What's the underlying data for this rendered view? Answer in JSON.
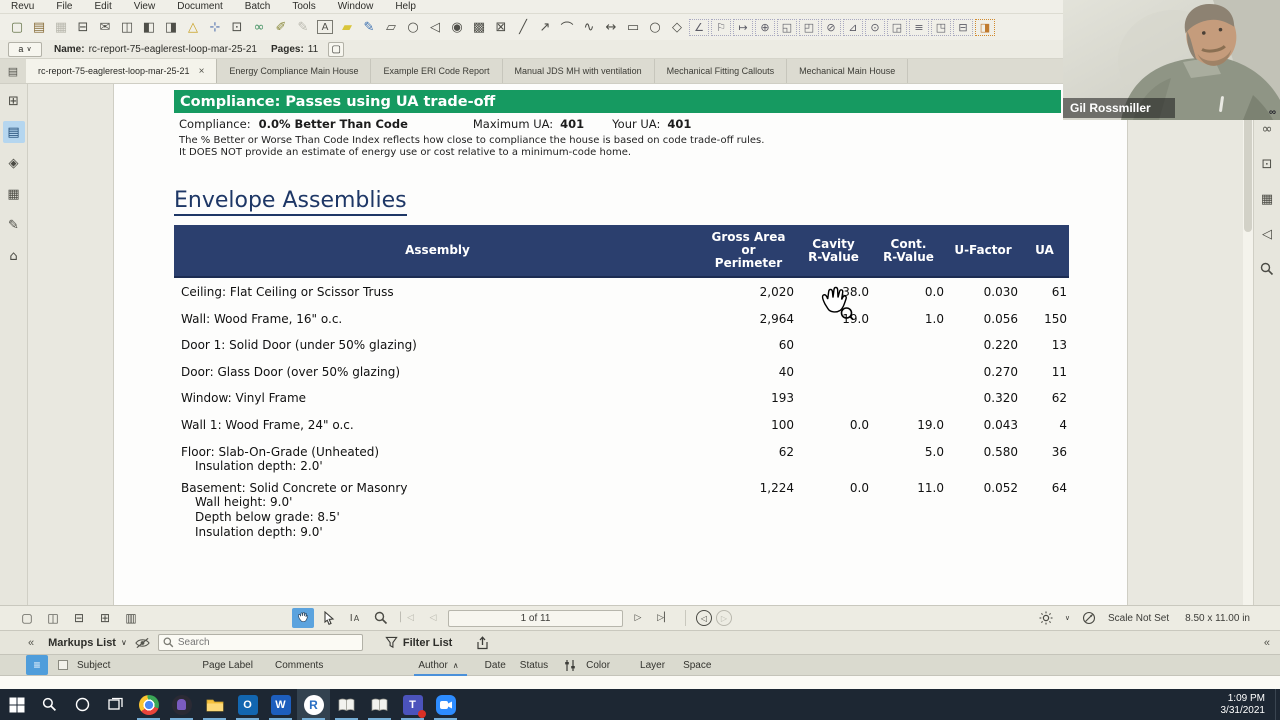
{
  "colors": {
    "banner_green": "#169a61",
    "table_navy": "#2b3f6e",
    "heading_navy": "#1e3766",
    "accent_blue": "#5ba3de",
    "taskbar_dark": "#1d2733"
  },
  "menu": {
    "items": [
      "Revu",
      "File",
      "Edit",
      "View",
      "Document",
      "Batch",
      "Tools",
      "Window",
      "Help"
    ]
  },
  "toolbar_icons": [
    {
      "n": "new-document-icon",
      "g": "▢",
      "c": "#66754a"
    },
    {
      "n": "open-file-icon",
      "g": "▤",
      "c": "#8a6f3c"
    },
    {
      "n": "save-icon",
      "g": "▦",
      "c": "#b9b8ae"
    },
    {
      "n": "print-icon",
      "g": "⊟",
      "c": "#4f4f49"
    },
    {
      "n": "email-icon",
      "g": "✉",
      "c": "#4f4f49"
    },
    {
      "n": "panels-layout-icon",
      "g": "◫",
      "c": "#4f4f49"
    },
    {
      "n": "extract-pages-icon",
      "g": "◧",
      "c": "#4f4f49"
    },
    {
      "n": "insert-pages-icon",
      "g": "◨",
      "c": "#4f4f49"
    },
    {
      "n": "alert-bell-icon",
      "g": "△",
      "c": "#c9a227"
    },
    {
      "n": "select-crosshair-icon",
      "g": "⊹",
      "c": "#4f6fae"
    },
    {
      "n": "snapshot-icon",
      "g": "⊡",
      "c": "#4f4f49"
    },
    {
      "n": "hyperlink-icon",
      "g": "∞",
      "c": "#3f8f5f"
    },
    {
      "n": "attachment-icon",
      "g": "✐",
      "c": "#8a8a3c"
    },
    {
      "n": "format-painter-icon",
      "g": "✎",
      "c": "#b9b8ae"
    },
    {
      "n": "text-box-icon",
      "g": "A",
      "c": "#4f4f49",
      "cls": "boxed"
    },
    {
      "n": "highlighter-icon",
      "g": "▰",
      "c": "#d9c53a"
    },
    {
      "n": "pen-icon",
      "g": "✎",
      "c": "#3a6fb0"
    },
    {
      "n": "cloud-icon",
      "g": "▱",
      "c": "#4f4f49"
    },
    {
      "n": "ellipse-markup-icon",
      "g": "○",
      "c": "#4f4f49"
    },
    {
      "n": "callout-icon",
      "g": "◁",
      "c": "#4f4f49"
    },
    {
      "n": "stamp-icon",
      "g": "◉",
      "c": "#4f4f49"
    },
    {
      "n": "image-icon",
      "g": "▩",
      "c": "#4f4f49"
    },
    {
      "n": "crop-icon",
      "g": "⊠",
      "c": "#4f4f49"
    },
    {
      "n": "line-tool-icon",
      "g": "╱",
      "c": "#4f4f49"
    },
    {
      "n": "arrow-tool-icon",
      "g": "↗",
      "c": "#4f4f49"
    },
    {
      "n": "arc-tool-icon",
      "g": "⌒",
      "c": "#4f4f49"
    },
    {
      "n": "polyline-tool-icon",
      "g": "∿",
      "c": "#4f4f49"
    },
    {
      "n": "dimension-tool-icon",
      "g": "↔",
      "c": "#4f4f49"
    },
    {
      "n": "rectangle-tool-icon",
      "g": "▭",
      "c": "#4f4f49"
    },
    {
      "n": "ellipse-tool-icon",
      "g": "○",
      "c": "#4f4f49"
    },
    {
      "n": "polygon-tool-icon",
      "g": "◇",
      "c": "#4f4f49"
    },
    {
      "n": "measure-angle-icon",
      "g": "∠",
      "cls": "measure"
    },
    {
      "n": "measure-flag-icon",
      "g": "⚐",
      "cls": "measure"
    },
    {
      "n": "measure-length-icon",
      "g": "↦",
      "cls": "measure"
    },
    {
      "n": "measure-calibrate-icon",
      "g": "⊕",
      "cls": "measure"
    },
    {
      "n": "measure-area-icon",
      "g": "◱",
      "cls": "measure"
    },
    {
      "n": "measure-perimeter-icon",
      "g": "◰",
      "cls": "measure"
    },
    {
      "n": "measure-diameter-icon",
      "g": "⊘",
      "cls": "measure"
    },
    {
      "n": "measure-slope-icon",
      "g": "⊿",
      "cls": "measure"
    },
    {
      "n": "measure-radius-icon",
      "g": "⊙",
      "cls": "measure"
    },
    {
      "n": "measure-volume-icon",
      "g": "◲",
      "cls": "measure"
    },
    {
      "n": "measure-count-icon",
      "g": "≡",
      "cls": "measure"
    },
    {
      "n": "measure-cutout-icon",
      "g": "◳",
      "cls": "measure"
    },
    {
      "n": "measure-width-icon",
      "g": "⊟",
      "cls": "measure"
    },
    {
      "n": "dynamic-fill-icon",
      "g": "◨",
      "cls": "measure dynfill",
      "c": "#c07a2e"
    }
  ],
  "namebar": {
    "doc_btn_label": "a",
    "name_label": "Name:",
    "name_value": "rc-report-75-eaglerest-loop-mar-25-21",
    "pages_label": "Pages:",
    "pages_value": "11"
  },
  "tabs": {
    "active_label": "rc-report-75-eaglerest-loop-mar-25-21",
    "close_glyph": "×",
    "others": [
      "Energy Compliance Main House",
      "Example ERI Code Report",
      "Manual JDS MH with ventilation",
      "Mechanical Fitting Callouts",
      "Mechanical Main House"
    ]
  },
  "left_panel_icons": [
    {
      "n": "thumbnails-panel-icon",
      "g": "⊞"
    },
    {
      "n": "bookmarks-panel-icon",
      "g": "▤",
      "active": true
    },
    {
      "n": "layers-panel-icon",
      "g": "◈"
    },
    {
      "n": "tool-chest-panel-icon",
      "g": "▦"
    },
    {
      "n": "signatures-panel-icon",
      "g": "✎"
    },
    {
      "n": "spaces-panel-icon",
      "g": "⌂"
    }
  ],
  "right_panel_icons": [
    {
      "n": "links-panel-icon",
      "g": "∞"
    },
    {
      "n": "windows-panel-icon",
      "g": "⊡"
    },
    {
      "n": "file-access-panel-icon",
      "g": "▦"
    },
    {
      "n": "tags-panel-icon",
      "g": "◁"
    },
    {
      "n": "search-panel-icon",
      "svg": "magnifier"
    }
  ],
  "doc": {
    "banner_text": "Compliance: Passes using UA trade-off",
    "compliance_label": "Compliance:",
    "compliance_value": "0.0% Better Than Code",
    "max_ua_label": "Maximum UA:",
    "max_ua_value": "401",
    "your_ua_label": "Your UA:",
    "your_ua_value": "401",
    "note_line1": "The % Better or Worse Than Code Index reflects  how close to compliance the house is based on code trade-off rules.",
    "note_line2": "It DOES NOT provide an estimate of energy use or cost relative to a minimum-code home.",
    "section_title": "Envelope Assemblies",
    "table": {
      "header": [
        {
          "lines": [
            "Assembly"
          ]
        },
        {
          "lines": [
            "Gross Area",
            "or",
            "Perimeter"
          ]
        },
        {
          "lines": [
            "Cavity",
            "R-Value"
          ]
        },
        {
          "lines": [
            "Cont.",
            "R-Value"
          ]
        },
        {
          "lines": [
            "U-Factor"
          ]
        },
        {
          "lines": [
            "UA"
          ]
        }
      ],
      "rows": [
        {
          "assembly": "Ceiling: Flat Ceiling or Scissor Truss",
          "details": [],
          "gross": "2,020",
          "cavity": "38.0",
          "cont": "0.0",
          "ufactor": "0.030",
          "ua": "61"
        },
        {
          "assembly": "Wall: Wood Frame, 16\" o.c.",
          "details": [],
          "gross": "2,964",
          "cavity": "19.0",
          "cont": "1.0",
          "ufactor": "0.056",
          "ua": "150"
        },
        {
          "assembly": "Door 1: Solid Door (under 50% glazing)",
          "details": [],
          "gross": "60",
          "cavity": "",
          "cont": "",
          "ufactor": "0.220",
          "ua": "13"
        },
        {
          "assembly": "Door: Glass Door (over 50% glazing)",
          "details": [],
          "gross": "40",
          "cavity": "",
          "cont": "",
          "ufactor": "0.270",
          "ua": "11"
        },
        {
          "assembly": "Window: Vinyl Frame",
          "details": [],
          "gross": "193",
          "cavity": "",
          "cont": "",
          "ufactor": "0.320",
          "ua": "62"
        },
        {
          "assembly": "Wall 1: Wood Frame, 24\" o.c.",
          "details": [],
          "gross": "100",
          "cavity": "0.0",
          "cont": "19.0",
          "ufactor": "0.043",
          "ua": "4"
        },
        {
          "assembly": "Floor: Slab-On-Grade (Unheated)",
          "details": [
            "Insulation depth: 2.0'"
          ],
          "gross": "62",
          "cavity": "",
          "cont": "5.0",
          "ufactor": "0.580",
          "ua": "36"
        },
        {
          "assembly": "Basement: Solid Concrete or Masonry",
          "details": [
            "Wall height: 9.0'",
            "Depth below grade: 8.5'",
            "Insulation depth: 9.0'"
          ],
          "gross": "1,224",
          "cavity": "0.0",
          "cont": "11.0",
          "ufactor": "0.052",
          "ua": "64"
        }
      ]
    }
  },
  "navbar": {
    "layout_icons": [
      {
        "n": "single-page-icon",
        "g": "▢"
      },
      {
        "n": "side-by-side-icon",
        "g": "◫"
      },
      {
        "n": "top-bottom-icon",
        "g": "⊟"
      },
      {
        "n": "insert-blank-page-icon",
        "g": "⊞"
      },
      {
        "n": "thumbnail-view-icon",
        "g": "▥"
      }
    ],
    "page_indicator": "1 of 11",
    "scale_label": "Scale Not Set",
    "page_size": "8.50 x 11.00 in"
  },
  "markups": {
    "collapse_glyph": "«",
    "title": "Markups List",
    "title_chevron": "∨",
    "search_placeholder": "Search",
    "filter_label": "Filter List",
    "columns": [
      "Subject",
      "Page Label",
      "Comments",
      "Author",
      "Date",
      "Status",
      "Color",
      "Layer",
      "Space"
    ],
    "sorted_column": "Author",
    "sort_glyph": "∧"
  },
  "taskbar": {
    "apps": [
      "start",
      "search",
      "cortana",
      "taskview",
      "chrome",
      "audio-app",
      "explorer",
      "outlook",
      "word",
      "revu",
      "book-1",
      "book-2",
      "teams",
      "meeting-cam"
    ],
    "time": "1:09 PM",
    "date": "3/31/2021"
  },
  "webcam": {
    "name_tag": "Gil Rossmiller",
    "logo": "∞"
  }
}
